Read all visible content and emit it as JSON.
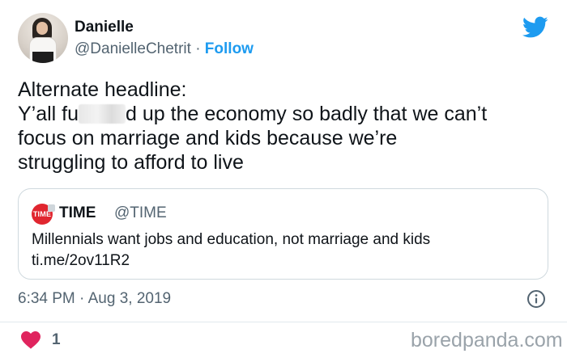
{
  "author": {
    "name": "Danielle",
    "handle": "@DanielleChetrit",
    "separator": "·",
    "follow_label": "Follow"
  },
  "tweet": {
    "line1": "Alternate headline:",
    "line2_before": "Y’all fu",
    "line2_after": "d up the economy so badly that we can’t",
    "line3": "focus on marriage and kids because we’re",
    "line4": "struggling to afford to live"
  },
  "quoted_tweet": {
    "logo_text": "TIME",
    "name": "TIME",
    "handle": "@TIME",
    "text": "Millennials want jobs and education, not marriage and kids",
    "link": "ti.me/2ov11R2"
  },
  "meta": {
    "time": "6:34 PM",
    "separator": "·",
    "date": "Aug 3, 2019"
  },
  "engagement": {
    "likes": "1"
  },
  "watermark": "boredpanda.com",
  "colors": {
    "accent": "#1d9bf0",
    "heart": "#e0245e",
    "muted": "#536471",
    "time_logo": "#e0262f"
  },
  "icons": {
    "brand": "twitter-bird-icon",
    "info": "info-icon",
    "like": "heart-icon"
  }
}
